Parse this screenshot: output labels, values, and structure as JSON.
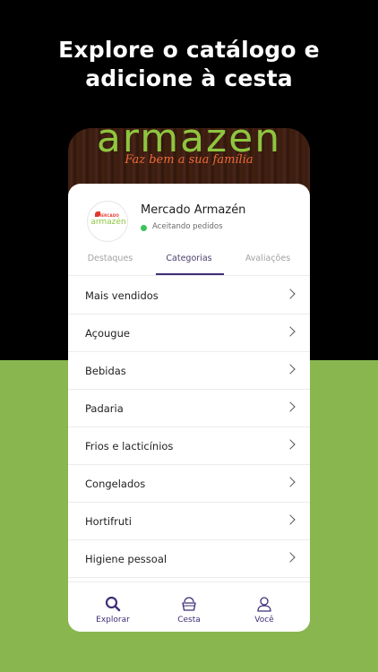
{
  "headline": {
    "line1": "Explore o catálogo e",
    "line2": "adicione à cesta"
  },
  "banner": {
    "brand": "armazén",
    "tagline": "Faz bem a sua família"
  },
  "store": {
    "logo_top": "MERCADO",
    "logo_main": "armazén",
    "name": "Mercado Armazén",
    "status": "Aceitando pedidos",
    "status_color": "#3cc35b"
  },
  "tabs": [
    {
      "label": "Destaques",
      "active": false
    },
    {
      "label": "Categorias",
      "active": true
    },
    {
      "label": "Avaliações",
      "active": false
    }
  ],
  "categories": [
    {
      "label": "Mais vendidos"
    },
    {
      "label": "Açougue"
    },
    {
      "label": "Bebidas"
    },
    {
      "label": "Padaria"
    },
    {
      "label": "Frios e lacticínios"
    },
    {
      "label": "Congelados"
    },
    {
      "label": "Hortifruti"
    },
    {
      "label": "Higiene pessoal"
    }
  ],
  "bottom_nav": [
    {
      "label": "Explorar",
      "icon": "search-icon"
    },
    {
      "label": "Cesta",
      "icon": "basket-icon"
    },
    {
      "label": "Você",
      "icon": "user-icon"
    }
  ],
  "colors": {
    "accent": "#3f2d78",
    "green_bg": "#8ab650",
    "brand_green": "#8ec63f"
  }
}
